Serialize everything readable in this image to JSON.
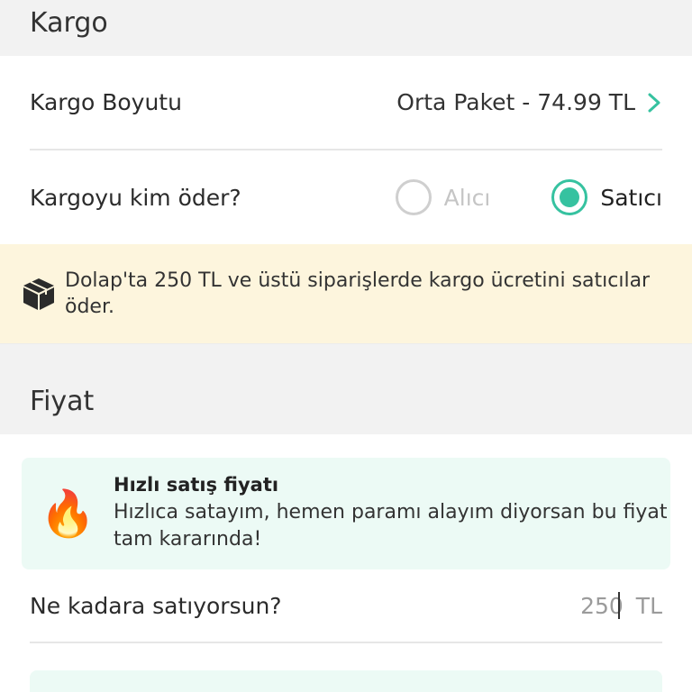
{
  "kargo": {
    "header": "Kargo",
    "size_label": "Kargo Boyutu",
    "size_value": "Orta Paket - 74.99 TL",
    "payer_question": "Kargoyu kim öder?",
    "options": [
      {
        "label": "Alıcı",
        "state": "disabled"
      },
      {
        "label": "Satıcı",
        "state": "selected"
      }
    ],
    "info_text": "Dolap'ta 250 TL ve üstü siparişlerde kargo ücretini satıcılar öder."
  },
  "fiyat": {
    "header": "Fiyat",
    "fast_title": "Hızlı satış fiyatı",
    "fast_desc": "Hızlıca satayım, hemen paramı alayım diyorsan bu fiyat tam kararında!",
    "fire_icon": "🔥",
    "price_question": "Ne kadara satıyorsun?",
    "price_value": "250",
    "currency": "TL"
  },
  "colors": {
    "accent": "#36c2a0",
    "banner_bg": "#fdf5dd",
    "card_bg": "#ecfaf5"
  }
}
